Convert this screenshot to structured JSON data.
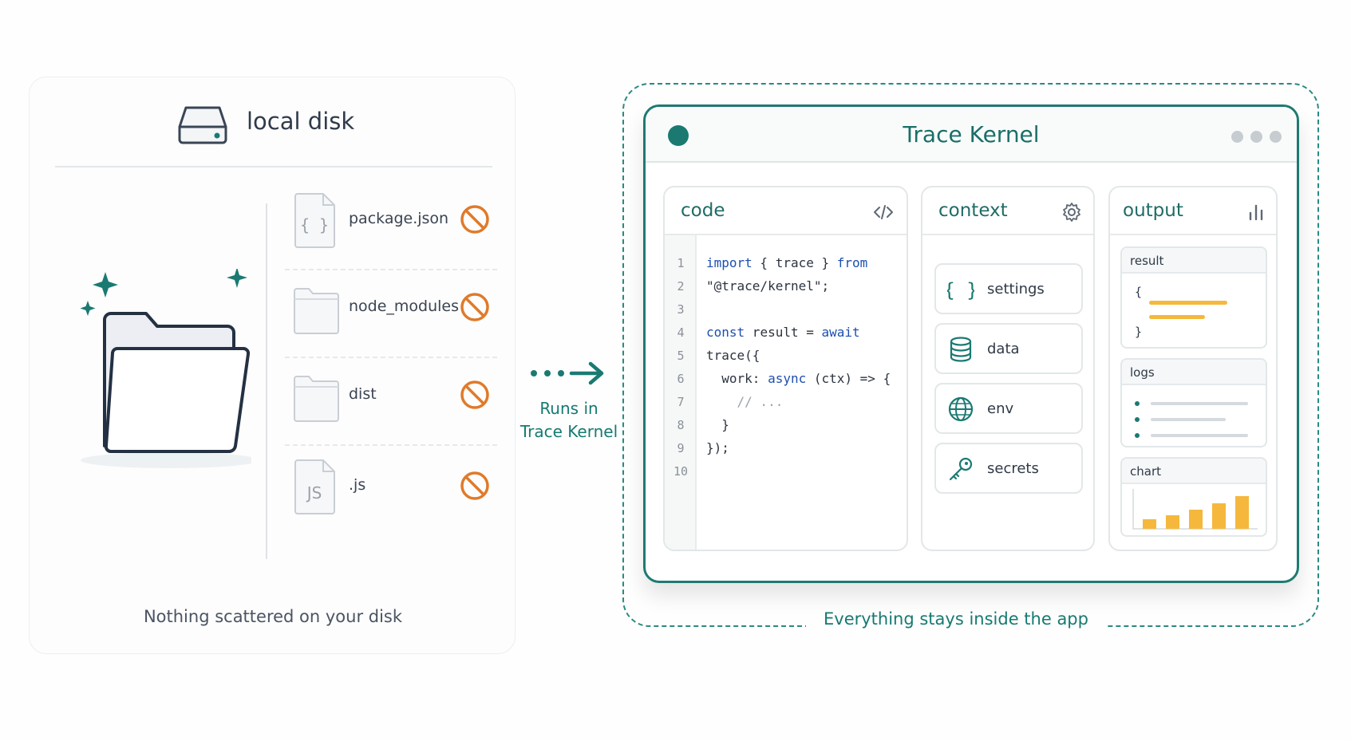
{
  "local_disk": {
    "title": "local disk",
    "caption": "Nothing scattered on your disk",
    "files": [
      {
        "name": "package.json",
        "icon": "json-file-icon",
        "blocked": true
      },
      {
        "name": "node_modules",
        "icon": "folder-icon",
        "blocked": true
      },
      {
        "name": "dist",
        "icon": "folder-icon",
        "blocked": true
      },
      {
        "name": ".js",
        "icon": "js-file-icon",
        "blocked": true
      }
    ],
    "file_icon_labels": {
      "json": "{ }",
      "js": "JS"
    }
  },
  "connector": {
    "label_line1": "Runs in",
    "label_line2": "Trace Kernel"
  },
  "app": {
    "title": "Trace Kernel",
    "caption": "Everything stays inside the app",
    "panes": {
      "code": {
        "title": "code",
        "line_numbers": [
          "1",
          "2",
          "3",
          "4",
          "5",
          "6",
          "7",
          "8",
          "9",
          "10"
        ],
        "lines": [
          [
            {
              "t": "import",
              "c": "kw"
            },
            {
              "t": " { trace } ",
              "c": ""
            },
            {
              "t": "from",
              "c": "kw"
            }
          ],
          [
            {
              "t": "\"@trace/kernel\";",
              "c": ""
            }
          ],
          [],
          [
            {
              "t": "const",
              "c": "kw"
            },
            {
              "t": " result = ",
              "c": ""
            },
            {
              "t": "await",
              "c": "kw"
            }
          ],
          [
            {
              "t": "trace({",
              "c": ""
            }
          ],
          [
            {
              "t": "  work: ",
              "c": ""
            },
            {
              "t": "async",
              "c": "kw"
            },
            {
              "t": " (ctx) => {",
              "c": ""
            }
          ],
          [
            {
              "t": "    // ...",
              "c": "cm"
            }
          ],
          [
            {
              "t": "  }",
              "c": ""
            }
          ],
          [
            {
              "t": "});",
              "c": ""
            }
          ],
          []
        ]
      },
      "context": {
        "title": "context",
        "items": [
          {
            "label": "settings",
            "icon": "braces-icon"
          },
          {
            "label": "data",
            "icon": "database-icon"
          },
          {
            "label": "env",
            "icon": "globe-icon"
          },
          {
            "label": "secrets",
            "icon": "key-icon"
          }
        ]
      },
      "output": {
        "title": "output",
        "cards": {
          "result": {
            "title": "result",
            "open_brace": "{",
            "close_brace": "}"
          },
          "logs": {
            "title": "logs"
          },
          "chart": {
            "title": "chart"
          }
        }
      }
    }
  },
  "colors": {
    "accent": "#1a7a72",
    "blocked": "#e07a2a",
    "highlight": "#f5b83d"
  }
}
